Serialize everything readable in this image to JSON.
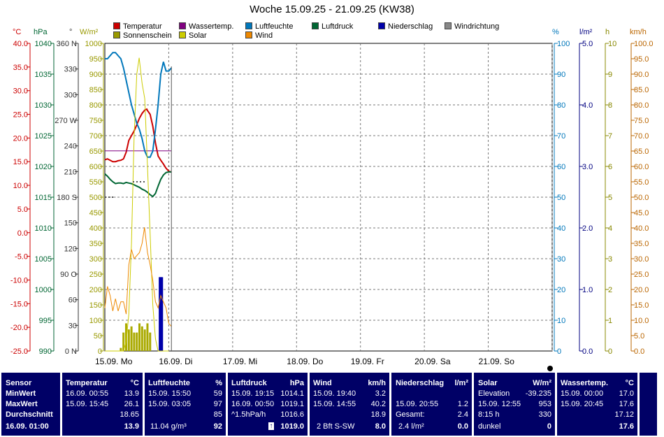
{
  "chart_data": {
    "type": "line",
    "title": "Woche 15.09.25 - 21.09.25 (KW38)",
    "x_categories": [
      "15.09. Mo",
      "16.09. Di",
      "17.09. Mi",
      "18.09. Do",
      "19.09. Fr",
      "20.09. Sa",
      "21.09. So"
    ],
    "x_range_hours": [
      0,
      168
    ],
    "grid": true,
    "axes": {
      "temperature": {
        "unit": "°C",
        "range": [
          -25,
          40
        ],
        "ticks": [
          "40.0",
          "35.0",
          "30.0",
          "25.0",
          "20.0",
          "15.0",
          "10.0",
          "5.0",
          "0.0",
          "-5.0",
          "-10.0",
          "-15.0",
          "-20.0",
          "-25.0"
        ],
        "color": "#cc0000"
      },
      "pressure": {
        "unit": "hPa",
        "range": [
          990,
          1040
        ],
        "ticks": [
          "1040",
          "1035",
          "1030",
          "1025",
          "1020",
          "1015",
          "1010",
          "1005",
          "1000",
          "995",
          "990"
        ],
        "color": "#006633"
      },
      "wind_dir": {
        "unit": "°",
        "range": [
          0,
          360
        ],
        "ticks": [
          "360 N",
          "330",
          "300",
          "270 W",
          "240",
          "210",
          "180 S",
          "150",
          "120",
          "90 O",
          "60",
          "30",
          "0 N"
        ],
        "color": "#333333"
      },
      "solar": {
        "unit": "W/m²",
        "range": [
          0,
          1000
        ],
        "ticks": [
          "1000",
          "950",
          "900",
          "850",
          "800",
          "750",
          "700",
          "650",
          "600",
          "550",
          "500",
          "450",
          "400",
          "350",
          "300",
          "250",
          "200",
          "150",
          "100",
          "50",
          "0"
        ],
        "color": "#999900"
      },
      "humidity": {
        "unit": "%",
        "range": [
          0,
          100
        ],
        "ticks": [
          "100",
          "90",
          "80",
          "70",
          "60",
          "50",
          "40",
          "30",
          "20",
          "10",
          "0"
        ],
        "color": "#0077bb"
      },
      "rain": {
        "unit": "l/m²",
        "range": [
          0,
          5
        ],
        "ticks": [
          "5.0",
          "4.0",
          "3.0",
          "2.0",
          "1.0",
          "0.0"
        ],
        "color": "#000080"
      },
      "sunshine": {
        "unit": "h",
        "range": [
          0,
          10
        ],
        "ticks": [
          "10",
          "9",
          "8",
          "7",
          "6",
          "5",
          "4",
          "3",
          "2",
          "1",
          "0"
        ],
        "color": "#888800"
      },
      "wind": {
        "unit": "km/h",
        "range": [
          0,
          100
        ],
        "ticks": [
          "100.0",
          "95.0",
          "90.0",
          "85.0",
          "80.0",
          "75.0",
          "70.0",
          "65.0",
          "60.0",
          "55.0",
          "50.0",
          "45.0",
          "40.0",
          "35.0",
          "30.0",
          "25.0",
          "20.0",
          "15.0",
          "10.0",
          "5.0",
          "0.0"
        ],
        "color": "#bb6600"
      }
    },
    "legend": [
      {
        "name": "Temperatur",
        "color": "#cc0000"
      },
      {
        "name": "Wassertemp.",
        "color": "#800080"
      },
      {
        "name": "Luftfeuchte",
        "color": "#0077bb"
      },
      {
        "name": "Luftdruck",
        "color": "#006633"
      },
      {
        "name": "Niederschlag",
        "color": "#0000aa"
      },
      {
        "name": "Windrichtung",
        "color": "#888888"
      },
      {
        "name": "Sonnenschein",
        "color": "#999900"
      },
      {
        "name": "Solar",
        "color": "#cccc00"
      },
      {
        "name": "Wind",
        "color": "#ee8800"
      }
    ],
    "series": [
      {
        "name": "Temperatur",
        "axis": "temperature",
        "color": "#cc0000",
        "x": [
          0,
          1,
          2,
          3,
          4,
          5,
          6,
          7,
          8,
          9,
          10,
          11,
          12,
          13,
          14,
          15,
          15.75,
          16,
          17,
          18,
          19,
          20,
          21,
          22,
          23,
          24,
          25
        ],
        "y": [
          15.4,
          15.6,
          15.3,
          15.0,
          15.0,
          15.2,
          15.3,
          15.6,
          17.0,
          19.5,
          20.5,
          21.5,
          22.8,
          24.2,
          25.2,
          25.9,
          26.1,
          25.8,
          25.0,
          22.5,
          19.0,
          16.2,
          15.3,
          14.5,
          13.6,
          13.0,
          12.8
        ]
      },
      {
        "name": "Wassertemp.",
        "axis": "temperature",
        "color": "#800080",
        "x": [
          0,
          25
        ],
        "y": [
          17.3,
          17.3
        ]
      },
      {
        "name": "Luftfeuchte",
        "axis": "humidity",
        "color": "#0077bb",
        "x": [
          0,
          1,
          2,
          3,
          4,
          5,
          6,
          7,
          8,
          9,
          10,
          11,
          12,
          13,
          14,
          15,
          16,
          17,
          18,
          19,
          20,
          21,
          22,
          23,
          24,
          25
        ],
        "y": [
          95,
          95,
          96,
          97,
          97,
          96,
          95,
          92,
          88,
          84,
          80,
          77,
          74,
          72,
          69,
          65,
          63,
          63,
          65,
          72,
          80,
          90,
          94,
          91,
          91,
          92
        ]
      },
      {
        "name": "Luftdruck",
        "axis": "pressure",
        "color": "#006633",
        "x": [
          0,
          1,
          2,
          3,
          4,
          5,
          6,
          7,
          8,
          9,
          10,
          11,
          12,
          13,
          14,
          15,
          16,
          17,
          18,
          19,
          20,
          21,
          22,
          23,
          24,
          25
        ],
        "y": [
          1018.8,
          1018.4,
          1017.9,
          1017.5,
          1017.2,
          1017.3,
          1017.3,
          1017.2,
          1017.4,
          1017.3,
          1017.2,
          1017.0,
          1016.8,
          1016.6,
          1016.3,
          1016.1,
          1015.8,
          1015.4,
          1015.1,
          1015.6,
          1016.8,
          1017.9,
          1018.6,
          1019.0,
          1019.1,
          1019.1
        ]
      },
      {
        "name": "Solar",
        "axis": "solar",
        "color": "#cccc00",
        "x": [
          0,
          1,
          2,
          3,
          4,
          5,
          6,
          7,
          8,
          9,
          10,
          11,
          12,
          12.9,
          14,
          15,
          16,
          17,
          18,
          19,
          20,
          21,
          22,
          23,
          24
        ],
        "y": [
          0,
          0,
          0,
          0,
          0,
          0,
          0,
          0,
          30,
          120,
          350,
          700,
          900,
          953,
          870,
          820,
          600,
          380,
          150,
          40,
          0,
          0,
          0,
          0,
          0
        ]
      },
      {
        "name": "Wind",
        "axis": "wind",
        "color": "#ee8800",
        "x": [
          0,
          1,
          2,
          3,
          4,
          5,
          6,
          7,
          8,
          9,
          10,
          11,
          12,
          13,
          14,
          14.9,
          16,
          17,
          18,
          19,
          20,
          21,
          22,
          23,
          24,
          25
        ],
        "y": [
          14,
          21,
          18,
          13,
          17,
          13,
          16,
          16,
          12,
          28,
          33,
          30,
          31,
          32,
          35,
          40.2,
          32,
          28,
          23,
          16,
          14,
          18,
          16,
          14,
          9,
          8
        ]
      },
      {
        "name": "Windrichtung",
        "axis": "wind_dir",
        "color": "#555555",
        "x": [
          0,
          4,
          4.5,
          9.5,
          10.5,
          15.5,
          16,
          20
        ],
        "y": [
          180,
          180,
          null,
          null,
          198,
          198,
          null,
          null
        ]
      }
    ],
    "bars": [
      {
        "name": "Niederschlag",
        "axis": "rain",
        "color": "#0000aa",
        "x": [
          20.9,
          21.2
        ],
        "y": [
          1.2,
          1.2
        ]
      },
      {
        "name": "Sonnenschein",
        "axis": "sunshine",
        "color": "#aaaa00",
        "x": [
          6,
          7,
          8,
          9,
          10,
          11,
          12,
          13,
          14,
          15,
          16,
          17
        ],
        "y": [
          0.1,
          0.6,
          0.9,
          0.7,
          0.8,
          0.6,
          0.6,
          0.9,
          0.8,
          0.7,
          0.9,
          0.6
        ]
      }
    ],
    "current_marker_hour": 25
  },
  "stats": {
    "sensor": {
      "header": "Sensor",
      "min": "MinWert",
      "max": "MaxWert",
      "avg": "Durchschnitt",
      "now": "16.09.  01:00"
    },
    "temperature": {
      "header": "Temperatur",
      "unit": "°C",
      "min_time": "16.09.  00:55",
      "min_val": "13.9",
      "max_time": "15.09.  15:45",
      "max_val": "26.1",
      "avg": "18.65",
      "now": "13.9"
    },
    "humidity": {
      "header": "Luftfeuchte",
      "unit": "%",
      "min_time": "15.09.  15:50",
      "min_val": "59",
      "max_time": "15.09.  03:05",
      "max_val": "97",
      "avg": "85",
      "extra": "11.04 g/m³",
      "now": "92"
    },
    "pressure": {
      "header": "Luftdruck",
      "unit": "hPa",
      "min_time": "15.09.  19:15",
      "min_val": "1014.1",
      "max_time": "16.09.  00:50",
      "max_val": "1019.1",
      "avg_label": "^1.5hPa/h",
      "avg": "1016.6",
      "now": "1019.0"
    },
    "wind": {
      "header": "Wind",
      "unit": "km/h",
      "min_time": "15.09.  19:40",
      "min_val": "3.2",
      "max_time": "15.09.  14:55",
      "max_val": "40.2",
      "avg": "18.9",
      "extra": "2 Bft S-SW",
      "now": "8.0"
    },
    "rain": {
      "header": "Niederschlag",
      "unit": "l/m²",
      "max_time": "15.09.  20:55",
      "max_val": "1.2",
      "total_label": "Gesamt:",
      "total": "2.4",
      "extra": "2.4 l/m²",
      "now": "0.0"
    },
    "solar": {
      "header": "Solar",
      "unit": "W/m²",
      "elev_label": "Elevation",
      "elev_val": "-39.235",
      "max_time": "15.09.  12:55",
      "max_val": "953",
      "sun_hours": "8:15 h",
      "sun_val": "330",
      "state": "dunkel",
      "now": "0"
    },
    "water": {
      "header": "Wassertemp.",
      "unit": "°C",
      "min_time": "15.09.  00:00",
      "min_val": "17.0",
      "max_time": "15.09.  20:45",
      "max_val": "17.6",
      "avg": "17.12",
      "now": "17.6"
    }
  }
}
